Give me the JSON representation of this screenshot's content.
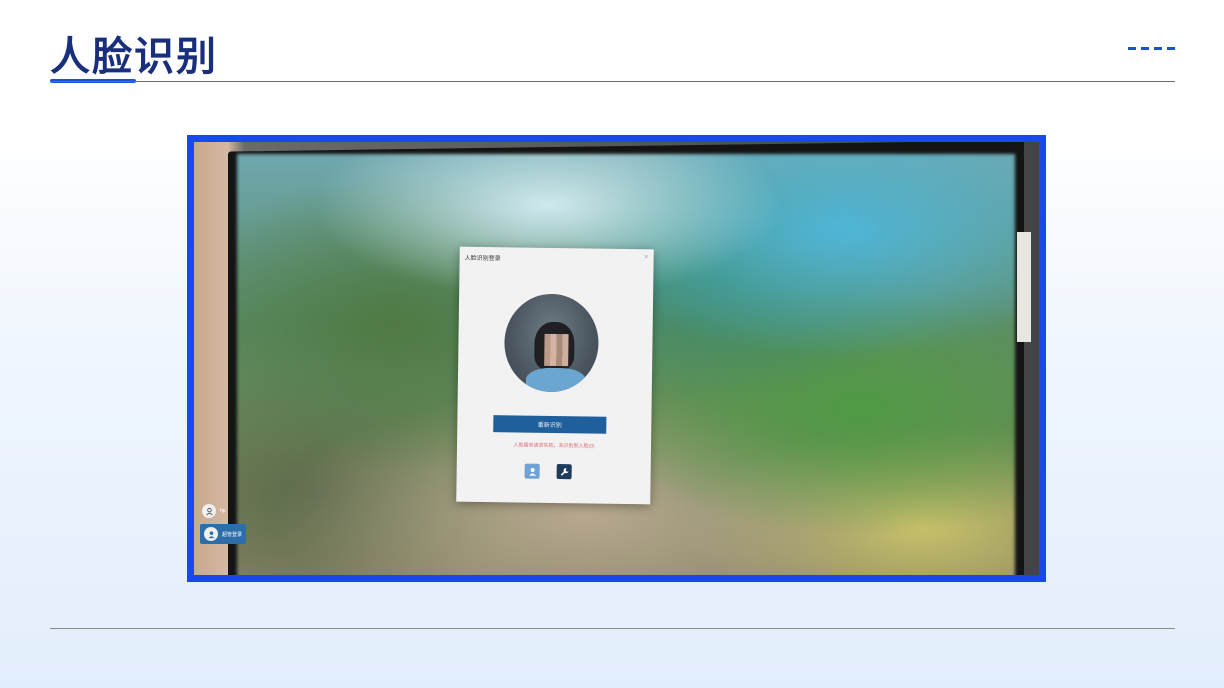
{
  "slide": {
    "title": "人脸识别"
  },
  "dialog": {
    "title": "人脸识别登录",
    "close_symbol": "×",
    "retry_button_label": "重新识别",
    "error_message": "人脸服务请求失败，未识别到人脸(0)"
  },
  "login_users": [
    {
      "label": "hp"
    },
    {
      "label": "超管登录"
    }
  ],
  "colors": {
    "title": "#1a2f7c",
    "accent": "#1e4fd8",
    "frame": "#1947f0",
    "button": "#1f5f9c",
    "error": "#e06a78"
  },
  "icons": [
    "user-icon",
    "wrench-icon",
    "avatar-icon"
  ]
}
